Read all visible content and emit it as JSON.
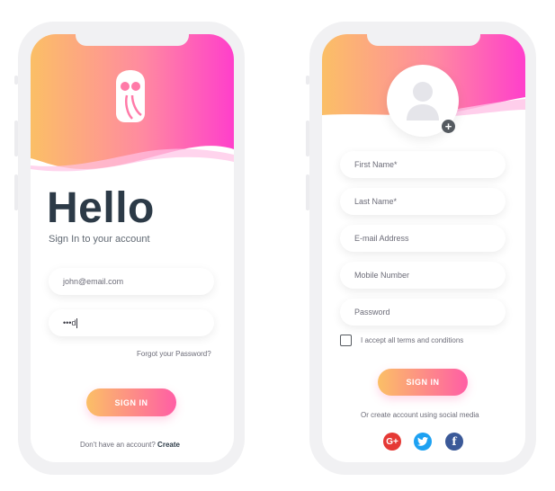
{
  "login": {
    "title": "Hello",
    "subtitle": "Sign In to your account",
    "email_value": "john@email.com",
    "password_value": "•••d",
    "forgot_label": "Forgot your Password?",
    "signin_label": "SIGN IN",
    "no_account_text": "Don't have an account?",
    "create_label": "Create"
  },
  "signup": {
    "first_name_placeholder": "First Name*",
    "last_name_placeholder": "Last Name*",
    "email_placeholder": "E-mail Address",
    "mobile_placeholder": "Mobile Number",
    "password_placeholder": "Password",
    "terms_label": "I accept all terms and conditions",
    "signin_label": "SIGN IN",
    "social_text": "Or create account using social media",
    "social": [
      {
        "name": "google-plus",
        "glyph": "G+",
        "color": "#e53935"
      },
      {
        "name": "twitter",
        "glyph": "t",
        "color": "#1da1f2"
      },
      {
        "name": "facebook",
        "glyph": "f",
        "color": "#3b5998"
      }
    ]
  },
  "colors": {
    "gradient_start": "#fbbf66",
    "gradient_end": "#ff44c6",
    "heading": "#2c3a47"
  }
}
